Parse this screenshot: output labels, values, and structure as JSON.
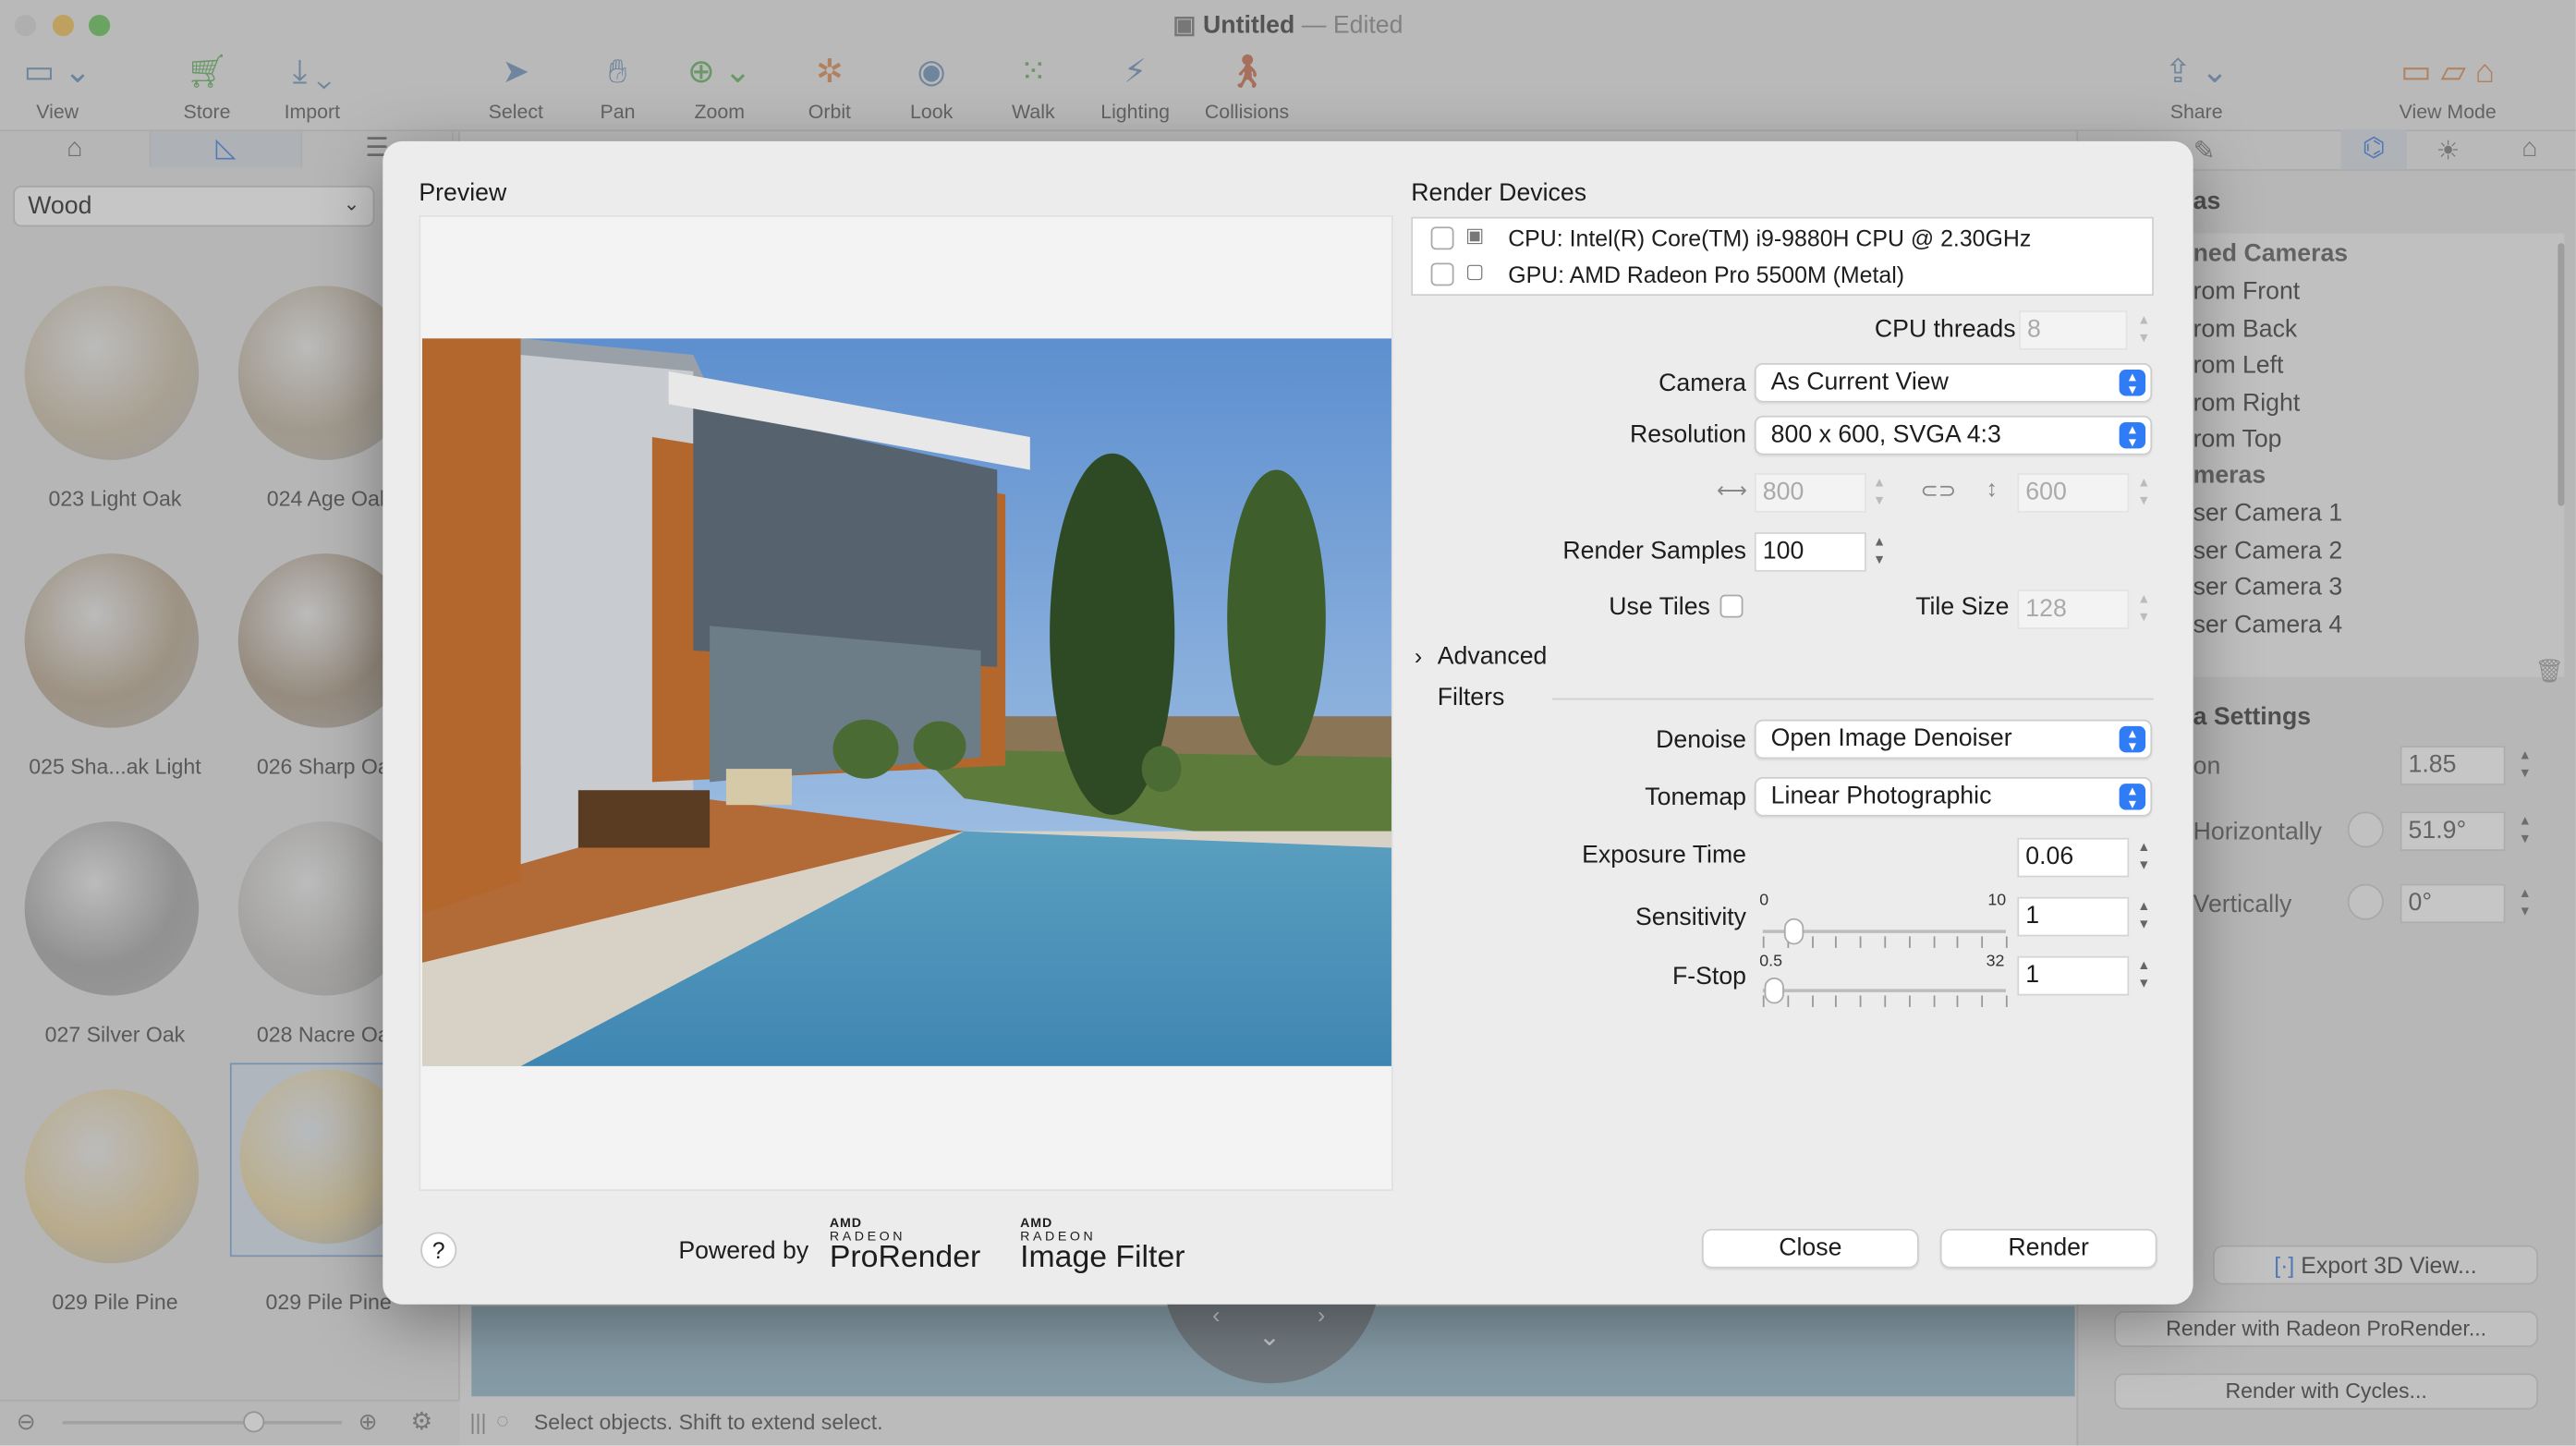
{
  "window": {
    "title": "Untitled",
    "subtitle": "Edited",
    "separator": "—"
  },
  "toolbar": {
    "items": [
      {
        "label": "View",
        "icon": "view-icon"
      },
      {
        "label": "Store",
        "icon": "cart-icon"
      },
      {
        "label": "Import",
        "icon": "import-icon"
      },
      {
        "label": "Select",
        "icon": "pointer-icon"
      },
      {
        "label": "Pan",
        "icon": "hand-icon"
      },
      {
        "label": "Zoom",
        "icon": "zoom-icon"
      },
      {
        "label": "Orbit",
        "icon": "orbit-icon"
      },
      {
        "label": "Look",
        "icon": "eye-icon"
      },
      {
        "label": "Walk",
        "icon": "walk-icon"
      },
      {
        "label": "Lighting",
        "icon": "lighting-icon"
      },
      {
        "label": "Collisions",
        "icon": "collisions-icon"
      },
      {
        "label": "Share",
        "icon": "share-icon"
      },
      {
        "label": "View Mode",
        "icon": "view-mode-icon"
      }
    ]
  },
  "materials": {
    "category": "Wood",
    "items": [
      {
        "label": "023 Light Oak",
        "color": "#cdbfa6"
      },
      {
        "label": "024 Age Oak",
        "color": "#c0b29d"
      },
      {
        "label": "025 Sha...ak Light",
        "color": "#b9a68c"
      },
      {
        "label": "026 Sharp Oak",
        "color": "#ad9a84"
      },
      {
        "label": "027 Silver Oak",
        "color": "#a4a4a6"
      },
      {
        "label": "028 Nacre Oak",
        "color": "#c4c2bf"
      },
      {
        "label": "029 Pile Pine",
        "color": "#e9d29c"
      },
      {
        "label": "029 Pile Pine",
        "color": "#ecd7a0"
      }
    ]
  },
  "right_panel": {
    "section_title": "as",
    "predefined_header": "ned Cameras",
    "predefined": [
      "rom Front",
      "rom Back",
      "rom Left",
      "rom Right",
      "rom Top"
    ],
    "cameras_header": "meras",
    "cameras": [
      "ser Camera 1",
      "ser Camera 2",
      "ser Camera 3",
      "ser Camera 4"
    ],
    "settings_title": "a Settings",
    "settings": [
      {
        "label": "on",
        "value": "1.85"
      },
      {
        "label": "Horizontally",
        "value": "51.9°"
      },
      {
        "label": "Vertically",
        "value": "0°"
      }
    ],
    "export_button": "Export 3D View...",
    "render_prorender_button": "Render with Radeon ProRender...",
    "render_cycles_button": "Render with Cycles..."
  },
  "status": {
    "text": "Select objects. Shift to extend select."
  },
  "dialog": {
    "preview_title": "Preview",
    "devices_title": "Render Devices",
    "devices": [
      {
        "label": "CPU: Intel(R) Core(TM) i9-9880H CPU @ 2.30GHz"
      },
      {
        "label": "GPU: AMD Radeon Pro 5500M (Metal)"
      }
    ],
    "cpu_threads_label": "CPU threads",
    "cpu_threads_value": "8",
    "camera_label": "Camera",
    "camera_value": "As Current View",
    "resolution_label": "Resolution",
    "resolution_value": "800 x 600, SVGA 4:3",
    "width_value": "800",
    "height_value": "600",
    "render_samples_label": "Render Samples",
    "render_samples_value": "100",
    "use_tiles_label": "Use Tiles",
    "tile_size_label": "Tile Size",
    "tile_size_value": "128",
    "advanced_label": "Advanced",
    "filters_label": "Filters",
    "denoise_label": "Denoise",
    "denoise_value": "Open Image Denoiser",
    "tonemap_label": "Tonemap",
    "tonemap_value": "Linear Photographic",
    "exposure_label": "Exposure Time",
    "exposure_value": "0.06",
    "sensitivity_label": "Sensitivity",
    "sensitivity_min": "0",
    "sensitivity_max": "10",
    "sensitivity_value": "1",
    "sensitivity_level": 0.1,
    "fstop_label": "F-Stop",
    "fstop_min": "0.5",
    "fstop_max": "32",
    "fstop_value": "1",
    "fstop_level": 0.02,
    "help_label": "?",
    "powered_by": "Powered by",
    "logo1_brand": "AMD",
    "logo1_sub": "RADEON",
    "logo1_name": "ProRender",
    "logo2_brand": "AMD",
    "logo2_sub": "RADEON",
    "logo2_name": "Image Filter",
    "close_button": "Close",
    "render_button": "Render"
  }
}
